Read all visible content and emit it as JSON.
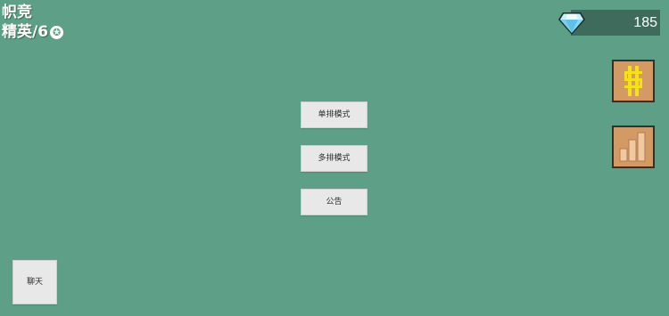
{
  "player": {
    "name": "帜竞",
    "rank": "精英/6"
  },
  "currency": {
    "gems": "185",
    "icon": "diamond-icon"
  },
  "side_buttons": [
    {
      "icon": "currency-icon"
    },
    {
      "icon": "bar-chart-icon"
    }
  ],
  "menu": {
    "single_mode": "单排模式",
    "multi_mode": "多排模式",
    "announcement": "公告"
  },
  "chat": {
    "label": "聊天"
  },
  "colors": {
    "background": "#5e9f88",
    "gem_bar": "#3e6b5c",
    "side_button": "#d49a64",
    "currency_symbol": "#f5e11a",
    "button_bg": "#e8e8e8"
  }
}
